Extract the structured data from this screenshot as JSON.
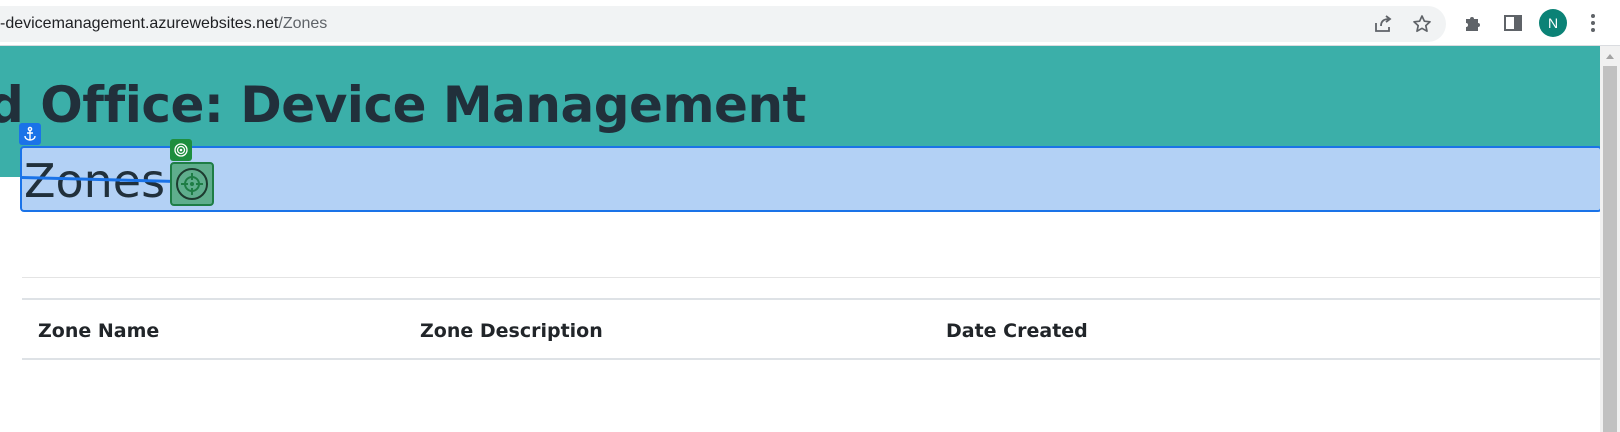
{
  "browser": {
    "url_host": "-devicemanagement.azurewebsites.net",
    "url_path": "/Zones",
    "share_icon": "share-icon",
    "bookmark_icon": "star-icon",
    "extensions_icon": "puzzle-icon",
    "sidepanel_icon": "side-panel-icon",
    "menu_icon": "kebab-menu-icon",
    "profile_initial": "N",
    "profile_color": "#0b8276"
  },
  "banner": {
    "title": "d Office: Device Management",
    "color": "#3bafa9"
  },
  "heading": {
    "title": "Zones",
    "overlay_color": "#b3d1f5",
    "overlay_border": "#1a73e8"
  },
  "table": {
    "columns": [
      "Zone Name",
      "Zone Description",
      "Date Created"
    ]
  }
}
